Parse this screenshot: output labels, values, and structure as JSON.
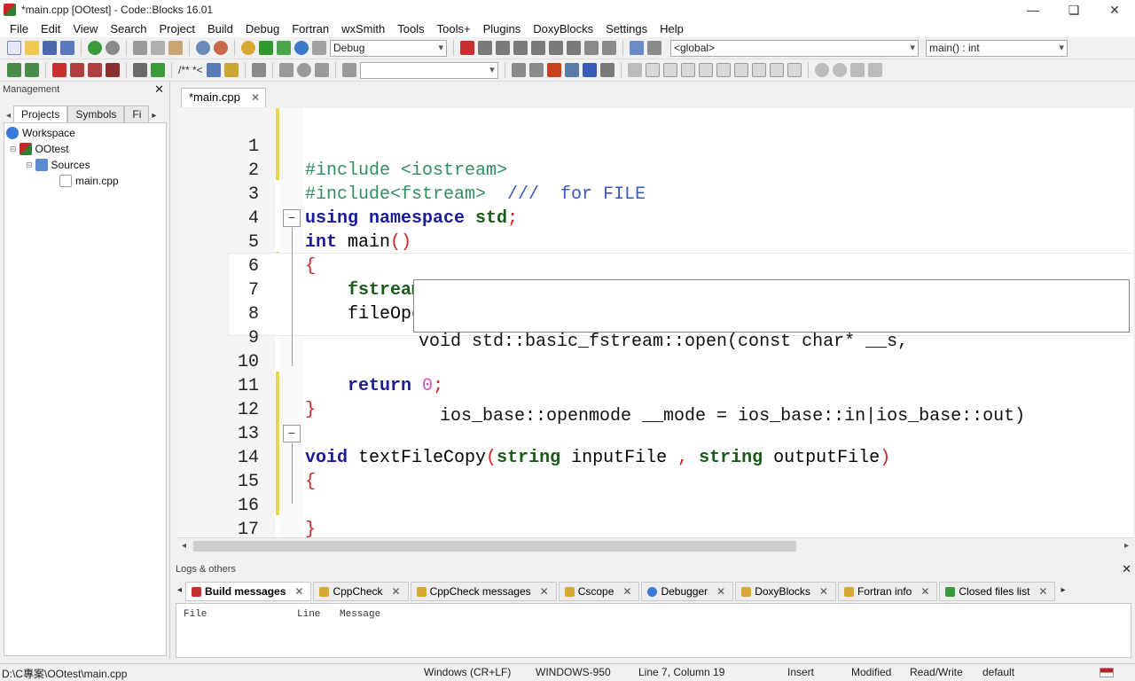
{
  "window": {
    "title": "*main.cpp [OOtest] - Code::Blocks 16.01",
    "controls": [
      "—",
      "❏",
      "✕"
    ]
  },
  "menu": [
    "File",
    "Edit",
    "View",
    "Search",
    "Project",
    "Build",
    "Debug",
    "Fortran",
    "wxSmith",
    "Tools",
    "Tools+",
    "Plugins",
    "DoxyBlocks",
    "Settings",
    "Help"
  ],
  "toolbar": {
    "build_target": "Debug",
    "scope": "<global>",
    "function": "main() : int",
    "comment_btn": "/** *<"
  },
  "management": {
    "title": "Management",
    "tabs": [
      "Projects",
      "Symbols",
      "Fi"
    ],
    "tree": {
      "workspace": "Workspace",
      "project": "OOtest",
      "folder": "Sources",
      "file": "main.cpp"
    }
  },
  "editor": {
    "tab_label": "*main.cpp",
    "line_numbers": [
      "1",
      "2",
      "3",
      "4",
      "5",
      "6",
      "7",
      "8",
      "9",
      "10",
      "11",
      "12",
      "13",
      "14",
      "15",
      "16",
      "17"
    ],
    "lines": {
      "l1": "#include <iostream>",
      "l2a": "#include<fstream>  ",
      "l2b": "///  for FILE",
      "l3a": "using namespace ",
      "l3b": "std",
      "l3c": ";",
      "l4a": "int",
      "l4b": " main",
      "l4c": "()",
      "l5": "{",
      "l6a": "    ",
      "l6b": "fstream",
      "l6c": " fileOpen",
      "l6d": ";",
      "l7a": "    fileOpen",
      "l7b": ".",
      "l7c": "open",
      "l7d": "(",
      "l7e": ")",
      "l10a": "    ",
      "l10b": "return",
      "l10c": " ",
      "l10d": "0",
      "l10e": ";",
      "l11": "}",
      "l13a": "void",
      "l13b": " textFileCopy",
      "l13c": "(",
      "l13d": "string",
      "l13e": " inputFile ",
      "l13f": ",",
      "l13g": " ",
      "l13h": "string",
      "l13i": " outputFile",
      "l13j": ")",
      "l14": "{",
      "l16": "}"
    },
    "calltip": {
      "line1": "void std::basic_fstream::open(const char* __s,",
      "line2": "  ios_base::openmode __mode = ios_base::in|ios_base::out)"
    }
  },
  "logs": {
    "title": "Logs & others",
    "tabs": [
      "Build messages",
      "CppCheck",
      "CppCheck messages",
      "Cscope",
      "Debugger",
      "DoxyBlocks",
      "Fortran info",
      "Closed files list"
    ],
    "columns": [
      "File",
      "Line",
      "Message"
    ]
  },
  "status": {
    "path": "D:\\C專案\\OOtest\\main.cpp",
    "eol": "Windows (CR+LF)",
    "encoding": "WINDOWS-950",
    "position": "Line 7, Column 19",
    "mode": "Insert",
    "modified": "Modified",
    "access": "Read/Write",
    "lang": "default"
  },
  "colors": {
    "keyword": "#1a1a9c",
    "type": "#1a5a1a",
    "preprocessor": "#2f8f5f",
    "comment": "#3a55c8",
    "operator": "#cc2222",
    "number": "#d050c0",
    "changebar": "#e8d84a",
    "brace_match": "#70e8e0"
  }
}
